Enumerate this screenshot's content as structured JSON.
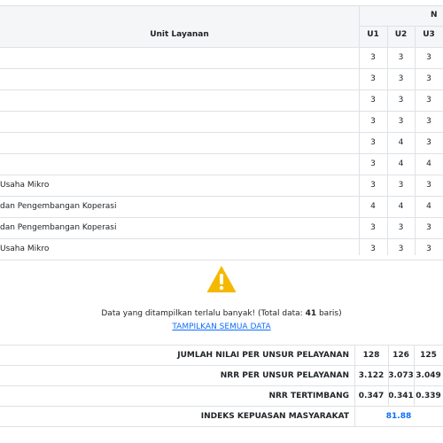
{
  "table": {
    "header": {
      "unit_layanan": "Unit Layanan",
      "group_partial": "N",
      "units": [
        "U1",
        "U2",
        "U3"
      ]
    },
    "rows": [
      {
        "name": "",
        "values": [
          "3",
          "3",
          "3"
        ]
      },
      {
        "name": "",
        "values": [
          "3",
          "3",
          "3"
        ]
      },
      {
        "name": "",
        "values": [
          "3",
          "3",
          "3"
        ]
      },
      {
        "name": "",
        "values": [
          "3",
          "3",
          "3"
        ]
      },
      {
        "name": "",
        "values": [
          "3",
          "4",
          "3"
        ]
      },
      {
        "name": "",
        "values": [
          "3",
          "4",
          "4"
        ]
      },
      {
        "name": "Usaha Mikro",
        "values": [
          "3",
          "3",
          "3"
        ]
      },
      {
        "name": "dan Pengembangan Koperasi",
        "values": [
          "4",
          "4",
          "4"
        ]
      },
      {
        "name": "dan Pengembangan Koperasi",
        "values": [
          "3",
          "3",
          "3"
        ]
      },
      {
        "name": "Usaha Mikro",
        "values": [
          "3",
          "3",
          "3"
        ]
      }
    ]
  },
  "notice": {
    "icon": "warning-triangle-icon",
    "icon_color": "#f5b800",
    "text_before": "Data yang ditampilkan terlalu banyak! (Total data: ",
    "total": "41",
    "text_after": " baris)",
    "show_all_link": "TAMPILKAN SEMUA DATA"
  },
  "summary": {
    "rows": [
      {
        "label": "JUMLAH NILAI PER UNSUR PELAYANAN",
        "values": [
          "128",
          "126",
          "125"
        ]
      },
      {
        "label": "NRR PER UNSUR PELAYANAN",
        "values": [
          "3.122",
          "3.073",
          "3.049"
        ]
      },
      {
        "label": "NRR TERTIMBANG",
        "values": [
          "0.347",
          "0.341",
          "0.339"
        ]
      }
    ],
    "ikm_label": "INDEKS KEPUASAN MASYARAKAT",
    "ikm_value": "81.88",
    "ikm_color": "#0d6efd"
  }
}
